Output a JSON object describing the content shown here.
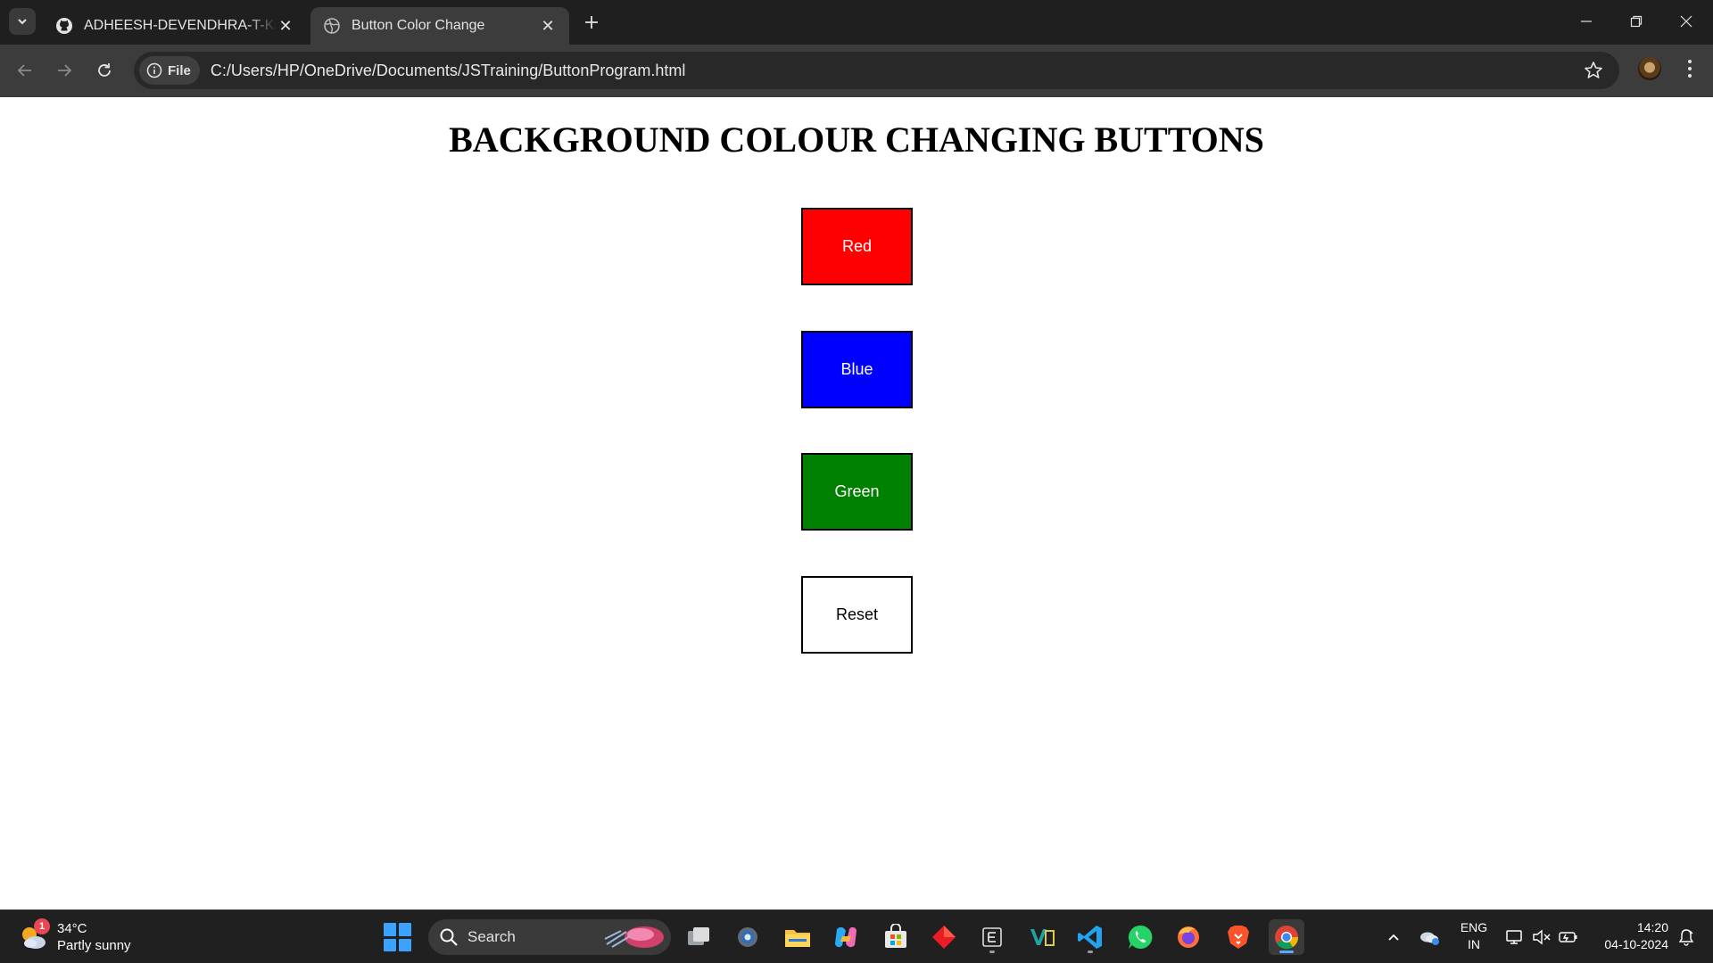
{
  "browser": {
    "tabs": [
      {
        "title": "ADHEESH-DEVENDHRA-T-K/Ba",
        "favicon": "github-icon",
        "active": false
      },
      {
        "title": "Button Color Change",
        "favicon": "globe-icon",
        "active": true
      }
    ],
    "security_chip": "File",
    "url": "C:/Users/HP/OneDrive/Documents/JSTraining/ButtonProgram.html"
  },
  "page": {
    "title": "BACKGROUND COLOUR CHANGING BUTTONS",
    "buttons": [
      {
        "label": "Red",
        "color": "#ff0000",
        "text_color": "#ffffff"
      },
      {
        "label": "Blue",
        "color": "#0000ff",
        "text_color": "#ffffff"
      },
      {
        "label": "Green",
        "color": "#008000",
        "text_color": "#ffffff"
      },
      {
        "label": "Reset",
        "color": "#ffffff",
        "text_color": "#000000"
      }
    ]
  },
  "taskbar": {
    "weather": {
      "temp": "34°C",
      "condition": "Partly sunny",
      "badge": "1"
    },
    "search_placeholder": "Search",
    "apps": [
      "start-icon",
      "task-view-icon",
      "settings-icon",
      "file-explorer-icon",
      "copilot-icon",
      "microsoft-store-icon",
      "app-diamond-icon",
      "app-e-icon",
      "visual-studio-icon",
      "vscode-icon",
      "whatsapp-icon",
      "firefox-icon",
      "brave-icon",
      "chrome-icon"
    ],
    "language": {
      "line1": "ENG",
      "line2": "IN"
    },
    "clock": {
      "time": "14:20",
      "date": "04-10-2024"
    }
  }
}
